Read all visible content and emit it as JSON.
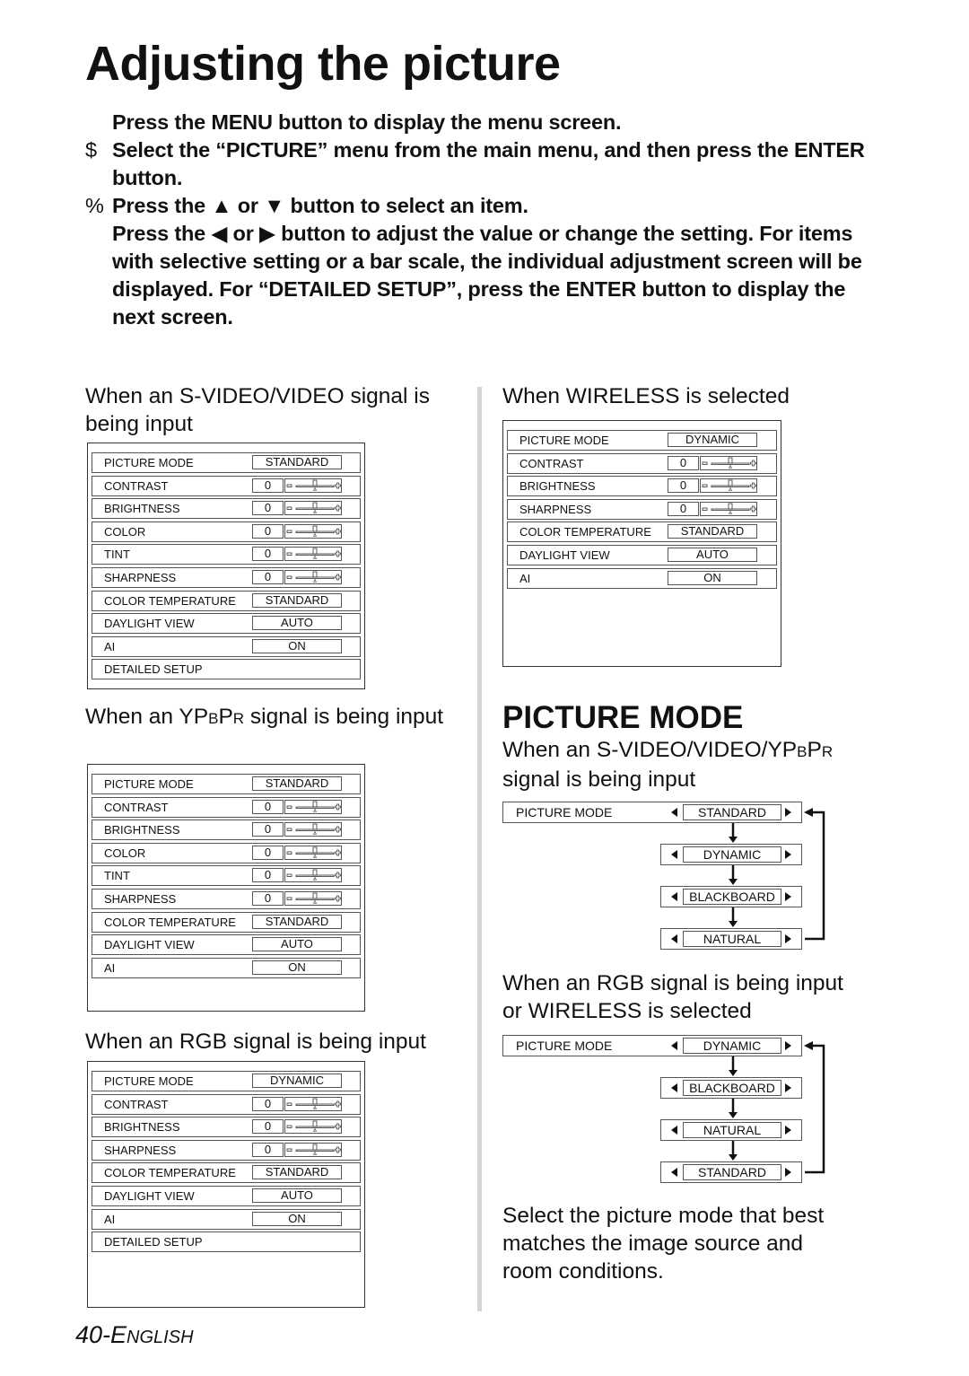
{
  "page": {
    "title": "Adjusting the picture",
    "footer_number": "40-",
    "footer_lang_initial": "E",
    "footer_lang_rest": "NGLISH"
  },
  "steps": [
    {
      "mark": "",
      "text": "Press the MENU button to display the menu screen."
    },
    {
      "mark": "$",
      "text": "Select the “PICTURE” menu from the main menu, and then press the ENTER button."
    },
    {
      "mark": "%",
      "text": "Press the ▲ or ▼ button to select an item."
    },
    {
      "mark": "",
      "text": "Press the ◀ or ▶ button to adjust the value or change the setting. For items with selective setting or a bar scale, the individual adjustment screen will be displayed. For “DETAILED SETUP”, press the ENTER button to display the next screen."
    }
  ],
  "screens": {
    "svideo": {
      "caption_a": "When an S-VIDEO/VIDEO signal is being input",
      "rows": [
        {
          "label": "PICTURE MODE",
          "value": "STANDARD"
        },
        {
          "label": "CONTRAST",
          "number": "0",
          "slider": 0.5
        },
        {
          "label": "BRIGHTNESS",
          "number": "0",
          "slider": 0.5
        },
        {
          "label": "COLOR",
          "number": "0",
          "slider": 0.5
        },
        {
          "label": "TINT",
          "number": "0",
          "slider": 0.5
        },
        {
          "label": "SHARPNESS",
          "number": "0",
          "slider": 0.5
        },
        {
          "label": "COLOR TEMPERATURE",
          "value": "STANDARD"
        },
        {
          "label": "DAYLIGHT VIEW",
          "value": "AUTO"
        },
        {
          "label": "AI",
          "value": "ON"
        },
        {
          "label": "DETAILED SETUP"
        }
      ]
    },
    "ypbpr": {
      "caption_a": "When an YP",
      "caption_b": "B",
      "caption_c": "P",
      "caption_d": "R",
      "caption_e": " signal is being input",
      "rows": [
        {
          "label": "PICTURE MODE",
          "value": "STANDARD"
        },
        {
          "label": "CONTRAST",
          "number": "0",
          "slider": 0.5
        },
        {
          "label": "BRIGHTNESS",
          "number": "0",
          "slider": 0.5
        },
        {
          "label": "COLOR",
          "number": "0",
          "slider": 0.5
        },
        {
          "label": "TINT",
          "number": "0",
          "slider": 0.5
        },
        {
          "label": "SHARPNESS",
          "number": "0",
          "slider": 0.5
        },
        {
          "label": "COLOR TEMPERATURE",
          "value": "STANDARD"
        },
        {
          "label": "DAYLIGHT VIEW",
          "value": "AUTO"
        },
        {
          "label": "AI",
          "value": "ON"
        }
      ]
    },
    "rgb": {
      "caption_a": "When an RGB signal is being input",
      "rows": [
        {
          "label": "PICTURE MODE",
          "value": "DYNAMIC"
        },
        {
          "label": "CONTRAST",
          "number": "0",
          "slider": 0.5
        },
        {
          "label": "BRIGHTNESS",
          "number": "0",
          "slider": 0.5
        },
        {
          "label": "SHARPNESS",
          "number": "0",
          "slider": 0.5
        },
        {
          "label": "COLOR TEMPERATURE",
          "value": "STANDARD"
        },
        {
          "label": "DAYLIGHT VIEW",
          "value": "AUTO"
        },
        {
          "label": "AI",
          "value": "ON"
        },
        {
          "label": "DETAILED SETUP"
        }
      ]
    },
    "wireless": {
      "caption_a": "When WIRELESS is selected",
      "rows": [
        {
          "label": "PICTURE MODE",
          "value": "DYNAMIC"
        },
        {
          "label": "CONTRAST",
          "number": "0",
          "slider": 0.5
        },
        {
          "label": "BRIGHTNESS",
          "number": "0",
          "slider": 0.5
        },
        {
          "label": "SHARPNESS",
          "number": "0",
          "slider": 0.5
        },
        {
          "label": "COLOR TEMPERATURE",
          "value": "STANDARD"
        },
        {
          "label": "DAYLIGHT VIEW",
          "value": "AUTO"
        },
        {
          "label": "AI",
          "value": "ON"
        }
      ]
    }
  },
  "picture_mode": {
    "heading": "PICTURE MODE",
    "flow1": {
      "caption_a": "When an S-VIDEO/VIDEO/YP",
      "caption_b": "B",
      "caption_c": "P",
      "caption_d": "R",
      "caption_e": "signal is being input",
      "label": "PICTURE MODE",
      "options": [
        "STANDARD",
        "DYNAMIC",
        "BLACKBOARD",
        "NATURAL"
      ]
    },
    "flow2": {
      "caption_a": "When an RGB signal is being input",
      "caption_b": "or WIRELESS is selected",
      "label": "PICTURE MODE",
      "options": [
        "DYNAMIC",
        "BLACKBOARD",
        "NATURAL",
        "STANDARD"
      ]
    },
    "description": "Select the picture mode that best matches the image source and room conditions."
  }
}
